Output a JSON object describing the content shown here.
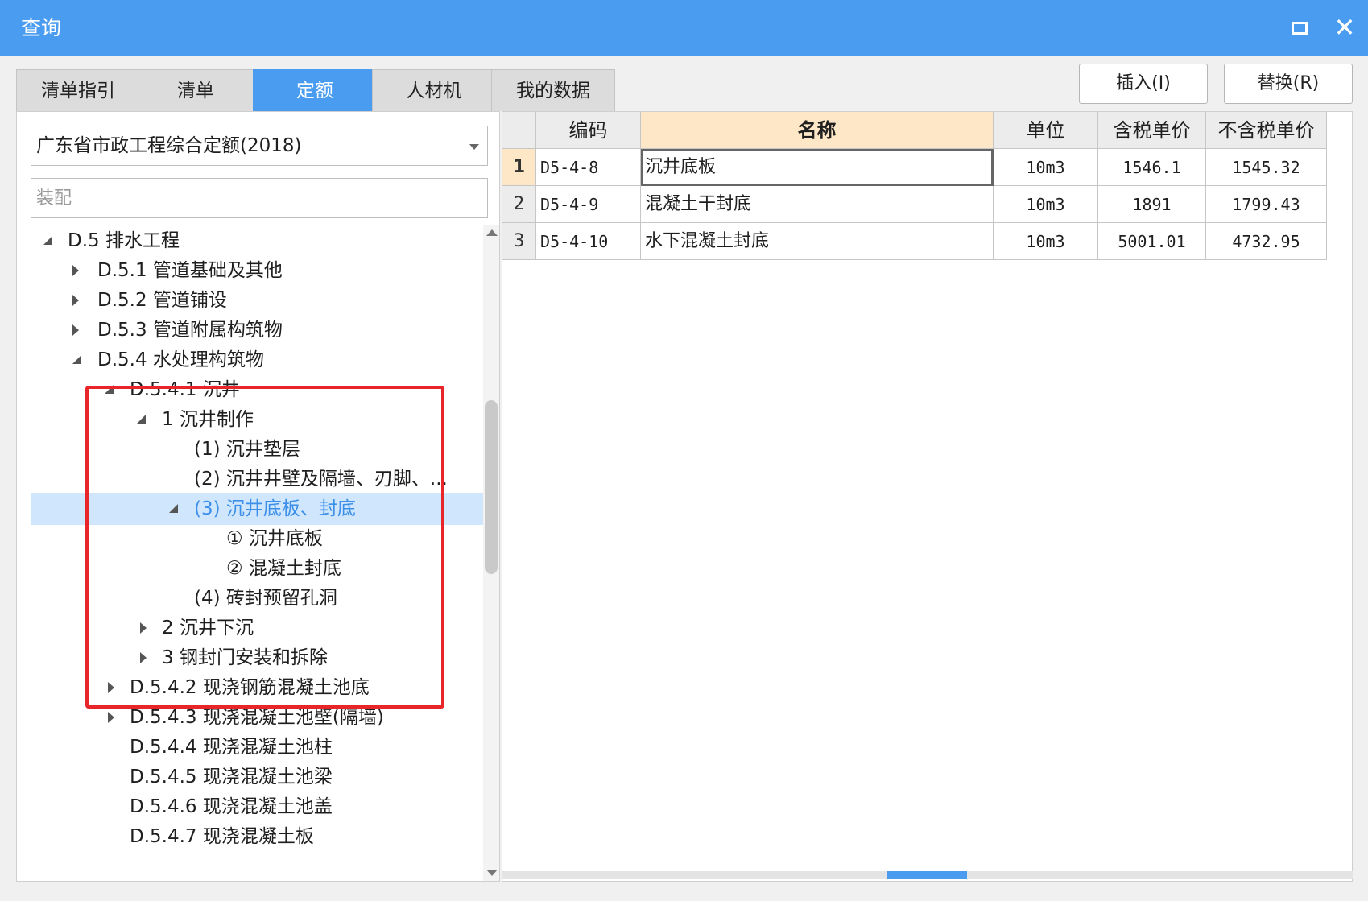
{
  "window": {
    "title": "查询"
  },
  "tabs": [
    {
      "label": "清单指引"
    },
    {
      "label": "清单"
    },
    {
      "label": "定额"
    },
    {
      "label": "人材机"
    },
    {
      "label": "我的数据"
    }
  ],
  "actions": {
    "insert_label": "插入(I)",
    "replace_label": "替换(R)"
  },
  "left": {
    "library_select": "广东省市政工程综合定额(2018)",
    "filter_placeholder": "装配"
  },
  "tree": [
    {
      "label": "D.5 排水工程"
    },
    {
      "label": "D.5.1 管道基础及其他"
    },
    {
      "label": "D.5.2 管道铺设"
    },
    {
      "label": "D.5.3 管道附属构筑物"
    },
    {
      "label": "D.5.4 水处理构筑物"
    },
    {
      "label": "D.5.4.1 沉井"
    },
    {
      "label": "1 沉井制作"
    },
    {
      "label": "(1) 沉井垫层"
    },
    {
      "label": "(2) 沉井井壁及隔墙、刃脚、..."
    },
    {
      "label": "(3) 沉井底板、封底"
    },
    {
      "label": "① 沉井底板"
    },
    {
      "label": "② 混凝土封底"
    },
    {
      "label": "(4) 砖封预留孔洞"
    },
    {
      "label": "2 沉井下沉"
    },
    {
      "label": "3 钢封门安装和拆除"
    },
    {
      "label": "D.5.4.2 现浇钢筋混凝土池底"
    },
    {
      "label": "D.5.4.3 现浇混凝土池壁(隔墙)"
    },
    {
      "label": "D.5.4.4 现浇混凝土池柱"
    },
    {
      "label": "D.5.4.5 现浇混凝土池梁"
    },
    {
      "label": "D.5.4.6 现浇混凝土池盖"
    },
    {
      "label": "D.5.4.7 现浇混凝土板"
    }
  ],
  "grid": {
    "headers": [
      "编码",
      "名称",
      "单位",
      "含税单价",
      "不含税单价"
    ],
    "rows": [
      {
        "num": "1",
        "code": "D5-4-8",
        "name": "沉井底板",
        "unit": "10m3",
        "price_tax": "1546.1",
        "price_notax": "1545.32"
      },
      {
        "num": "2",
        "code": "D5-4-9",
        "name": "混凝土干封底",
        "unit": "10m3",
        "price_tax": "1891",
        "price_notax": "1799.43"
      },
      {
        "num": "3",
        "code": "D5-4-10",
        "name": "水下混凝土封底",
        "unit": "10m3",
        "price_tax": "5001.01",
        "price_notax": "4732.95"
      }
    ]
  },
  "icons": {
    "maximize": "maximize-icon",
    "close": "close-icon",
    "dropdown": "chevron-down-icon",
    "tree_expanded": "triangle-expanded-icon",
    "tree_collapsed": "triangle-collapsed-icon"
  },
  "colors": {
    "accent": "#4a9cf0",
    "highlight": "#e8262a",
    "selection": "#cfe6fd",
    "active_header": "#fde7c6"
  }
}
